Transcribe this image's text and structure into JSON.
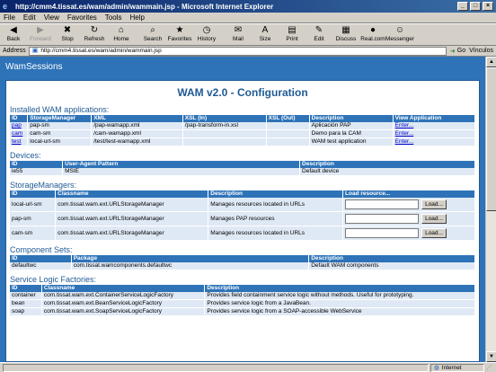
{
  "browser": {
    "title": "http://cmm4.tissat.es/wam/admin/wammain.jsp - Microsoft Internet Explorer",
    "menu": [
      "File",
      "Edit",
      "View",
      "Favorites",
      "Tools",
      "Help"
    ],
    "toolbar": [
      {
        "label": "Back",
        "icon": "back-arrow-icon",
        "glyph": "◀"
      },
      {
        "label": "Forward",
        "icon": "forward-arrow-icon",
        "glyph": "▶",
        "disabled": true
      },
      {
        "label": "Stop",
        "icon": "stop-icon",
        "glyph": "✖"
      },
      {
        "label": "Refresh",
        "icon": "refresh-icon",
        "glyph": "↻"
      },
      {
        "label": "Home",
        "icon": "home-icon",
        "glyph": "⌂"
      },
      {
        "label": "Search",
        "icon": "search-icon",
        "glyph": "⌕"
      },
      {
        "label": "Favorites",
        "icon": "favorites-icon",
        "glyph": "★"
      },
      {
        "label": "History",
        "icon": "history-icon",
        "glyph": "◷"
      },
      {
        "label": "Mail",
        "icon": "mail-icon",
        "glyph": "✉"
      },
      {
        "label": "Size",
        "icon": "font-size-icon",
        "glyph": "A"
      },
      {
        "label": "Print",
        "icon": "print-icon",
        "glyph": "▤"
      },
      {
        "label": "Edit",
        "icon": "edit-icon",
        "glyph": "✎"
      },
      {
        "label": "Discuss",
        "icon": "discuss-icon",
        "glyph": "▦"
      },
      {
        "label": "Real.com",
        "icon": "realcom-icon",
        "glyph": "●"
      },
      {
        "label": "Messenger",
        "icon": "messenger-icon",
        "glyph": "☺"
      }
    ],
    "address_label": "Address",
    "address_value": "http://cmm4.tissat.es/wam/admin/wammain.jsp",
    "go_label": "Go",
    "links_label": "Vínculos",
    "status_text": "",
    "zone_label": "Internet"
  },
  "page": {
    "brand": "WamSessions",
    "title": "WAM v2.0 - Configuration",
    "apps": {
      "heading": "Installed WAM applications:",
      "columns": [
        "ID",
        "StorageManager",
        "XML",
        "XSL (In)",
        "XSL (Out)",
        "Description",
        "View Application"
      ],
      "rows": [
        [
          "pap",
          "pap-sm",
          "/pap-wamapp.xml",
          "/pap-transform-in.xsl",
          "",
          "Aplicación PAP",
          "Enter..."
        ],
        [
          "cam",
          "cam-sm",
          "/cam-wamapp.xml",
          "",
          "",
          "Demo para la CAM",
          "Enter..."
        ],
        [
          "test",
          "local-url-sm",
          "/test/test-wamapp.xml",
          "",
          "",
          "WAM test application",
          "Enter..."
        ]
      ]
    },
    "devices": {
      "heading": "Devices:",
      "columns": [
        "ID",
        "User-Agent Pattern",
        "Description"
      ],
      "rows": [
        [
          "ie55",
          "MSIE",
          "Default device"
        ]
      ]
    },
    "storage": {
      "heading": "StorageManagers:",
      "columns": [
        "ID",
        "Classname",
        "Description",
        "Load resource..."
      ],
      "button": "Load...",
      "rows": [
        [
          "local-url-sm",
          "com.tissat.wam.ext.URLStorageManager",
          "Manages resources located in URLs"
        ],
        [
          "pap-sm",
          "com.tissat.wam.ext.URLStorageManager",
          "Manages PAP resources"
        ],
        [
          "cam-sm",
          "com.tissat.wam.ext.URLStorageManager",
          "Manages resources located in URLs"
        ]
      ]
    },
    "components": {
      "heading": "Component Sets:",
      "columns": [
        "ID",
        "Package",
        "Description"
      ],
      "rows": [
        [
          "defaultwc",
          "com.tissat.wamcomponents.defaultwc",
          "Default WAM components"
        ]
      ]
    },
    "factories": {
      "heading": "Service Logic Factories:",
      "columns": [
        "ID",
        "Classname",
        "Description"
      ],
      "rows": [
        [
          "container",
          "com.tissat.wam.ext.ContainerServiceLogicFactory",
          "Provides field containment service logic without methods. Useful for prototyping."
        ],
        [
          "bean",
          "com.tissat.wam.ext.BeanServiceLogicFactory",
          "Provides service logic from a JavaBean."
        ],
        [
          "soap",
          "com.tissat.wam.ext.SoapServiceLogicFactory",
          "Provides service logic from a SOAP-accessible WebService"
        ]
      ]
    }
  }
}
